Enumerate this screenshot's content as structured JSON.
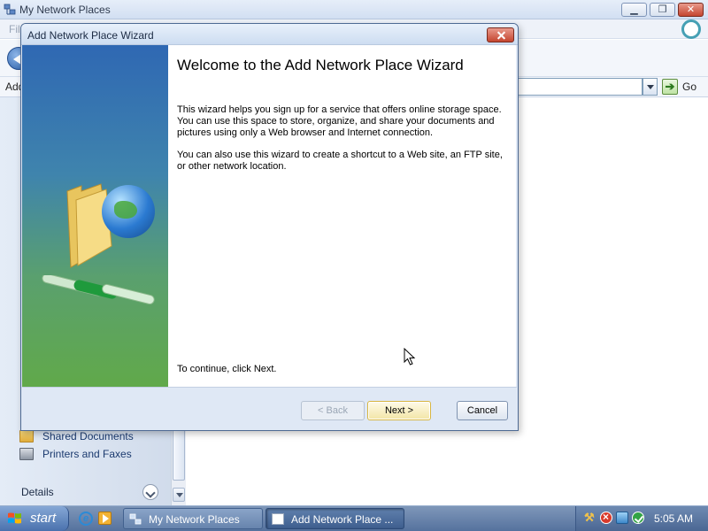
{
  "explorer": {
    "title": "My Network Places",
    "menu_first": "Fil",
    "address_label": "Add",
    "go_label": "Go",
    "left_pane": {
      "items": [
        {
          "label": "Shared Documents",
          "icon": "folder-icon"
        },
        {
          "label": "Printers and Faxes",
          "icon": "printer-icon"
        }
      ],
      "details_label": "Details"
    }
  },
  "wizard": {
    "title": "Add Network Place Wizard",
    "heading": "Welcome to the Add Network Place Wizard",
    "paragraph1": "This wizard helps you sign up for a service that offers online storage space. You can use this space to store, organize, and share your documents and pictures using only a Web browser and Internet connection.",
    "paragraph2": "You can also use this wizard to create a shortcut to a Web site, an FTP site, or other network location.",
    "continue_text": "To continue, click Next.",
    "buttons": {
      "back": "< Back",
      "next": "Next >",
      "cancel": "Cancel"
    }
  },
  "taskbar": {
    "start_label": "start",
    "tasks": [
      {
        "label": "My Network Places",
        "active": false
      },
      {
        "label": "Add Network Place ...",
        "active": true
      }
    ],
    "tray": {
      "icons": [
        "tools-icon",
        "security-alert-icon",
        "network-icon",
        "update-icon"
      ],
      "clock": "5:05 AM"
    }
  },
  "colors": {
    "taskbar": "#55729e",
    "wizard_banner_top": "#2f68b3",
    "wizard_banner_bottom": "#61a94a",
    "close_button": "#c4452f"
  }
}
